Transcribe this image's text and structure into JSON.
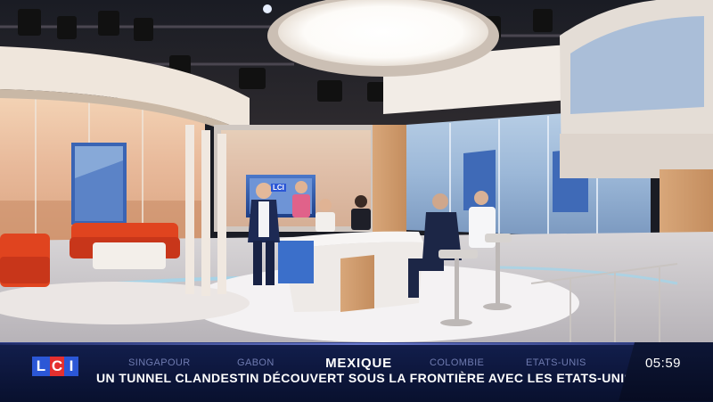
{
  "broadcast": {
    "channel_logo": "LCI",
    "colors": {
      "logo_blue": "#2b57d6",
      "logo_red": "#e5302f",
      "ticker_bg": "#0f1a44"
    },
    "ticker": {
      "countries": [
        "SINGAPOUR",
        "GABON",
        "COLOMBIE",
        "ETATS-UNIS"
      ],
      "topic": "MEXIQUE",
      "headline": "UN TUNNEL CLANDESTIN DÉCOUVERT SOUS LA FRONTIÈRE AVEC LES ETATS-UNIS",
      "time": "05:59"
    }
  }
}
